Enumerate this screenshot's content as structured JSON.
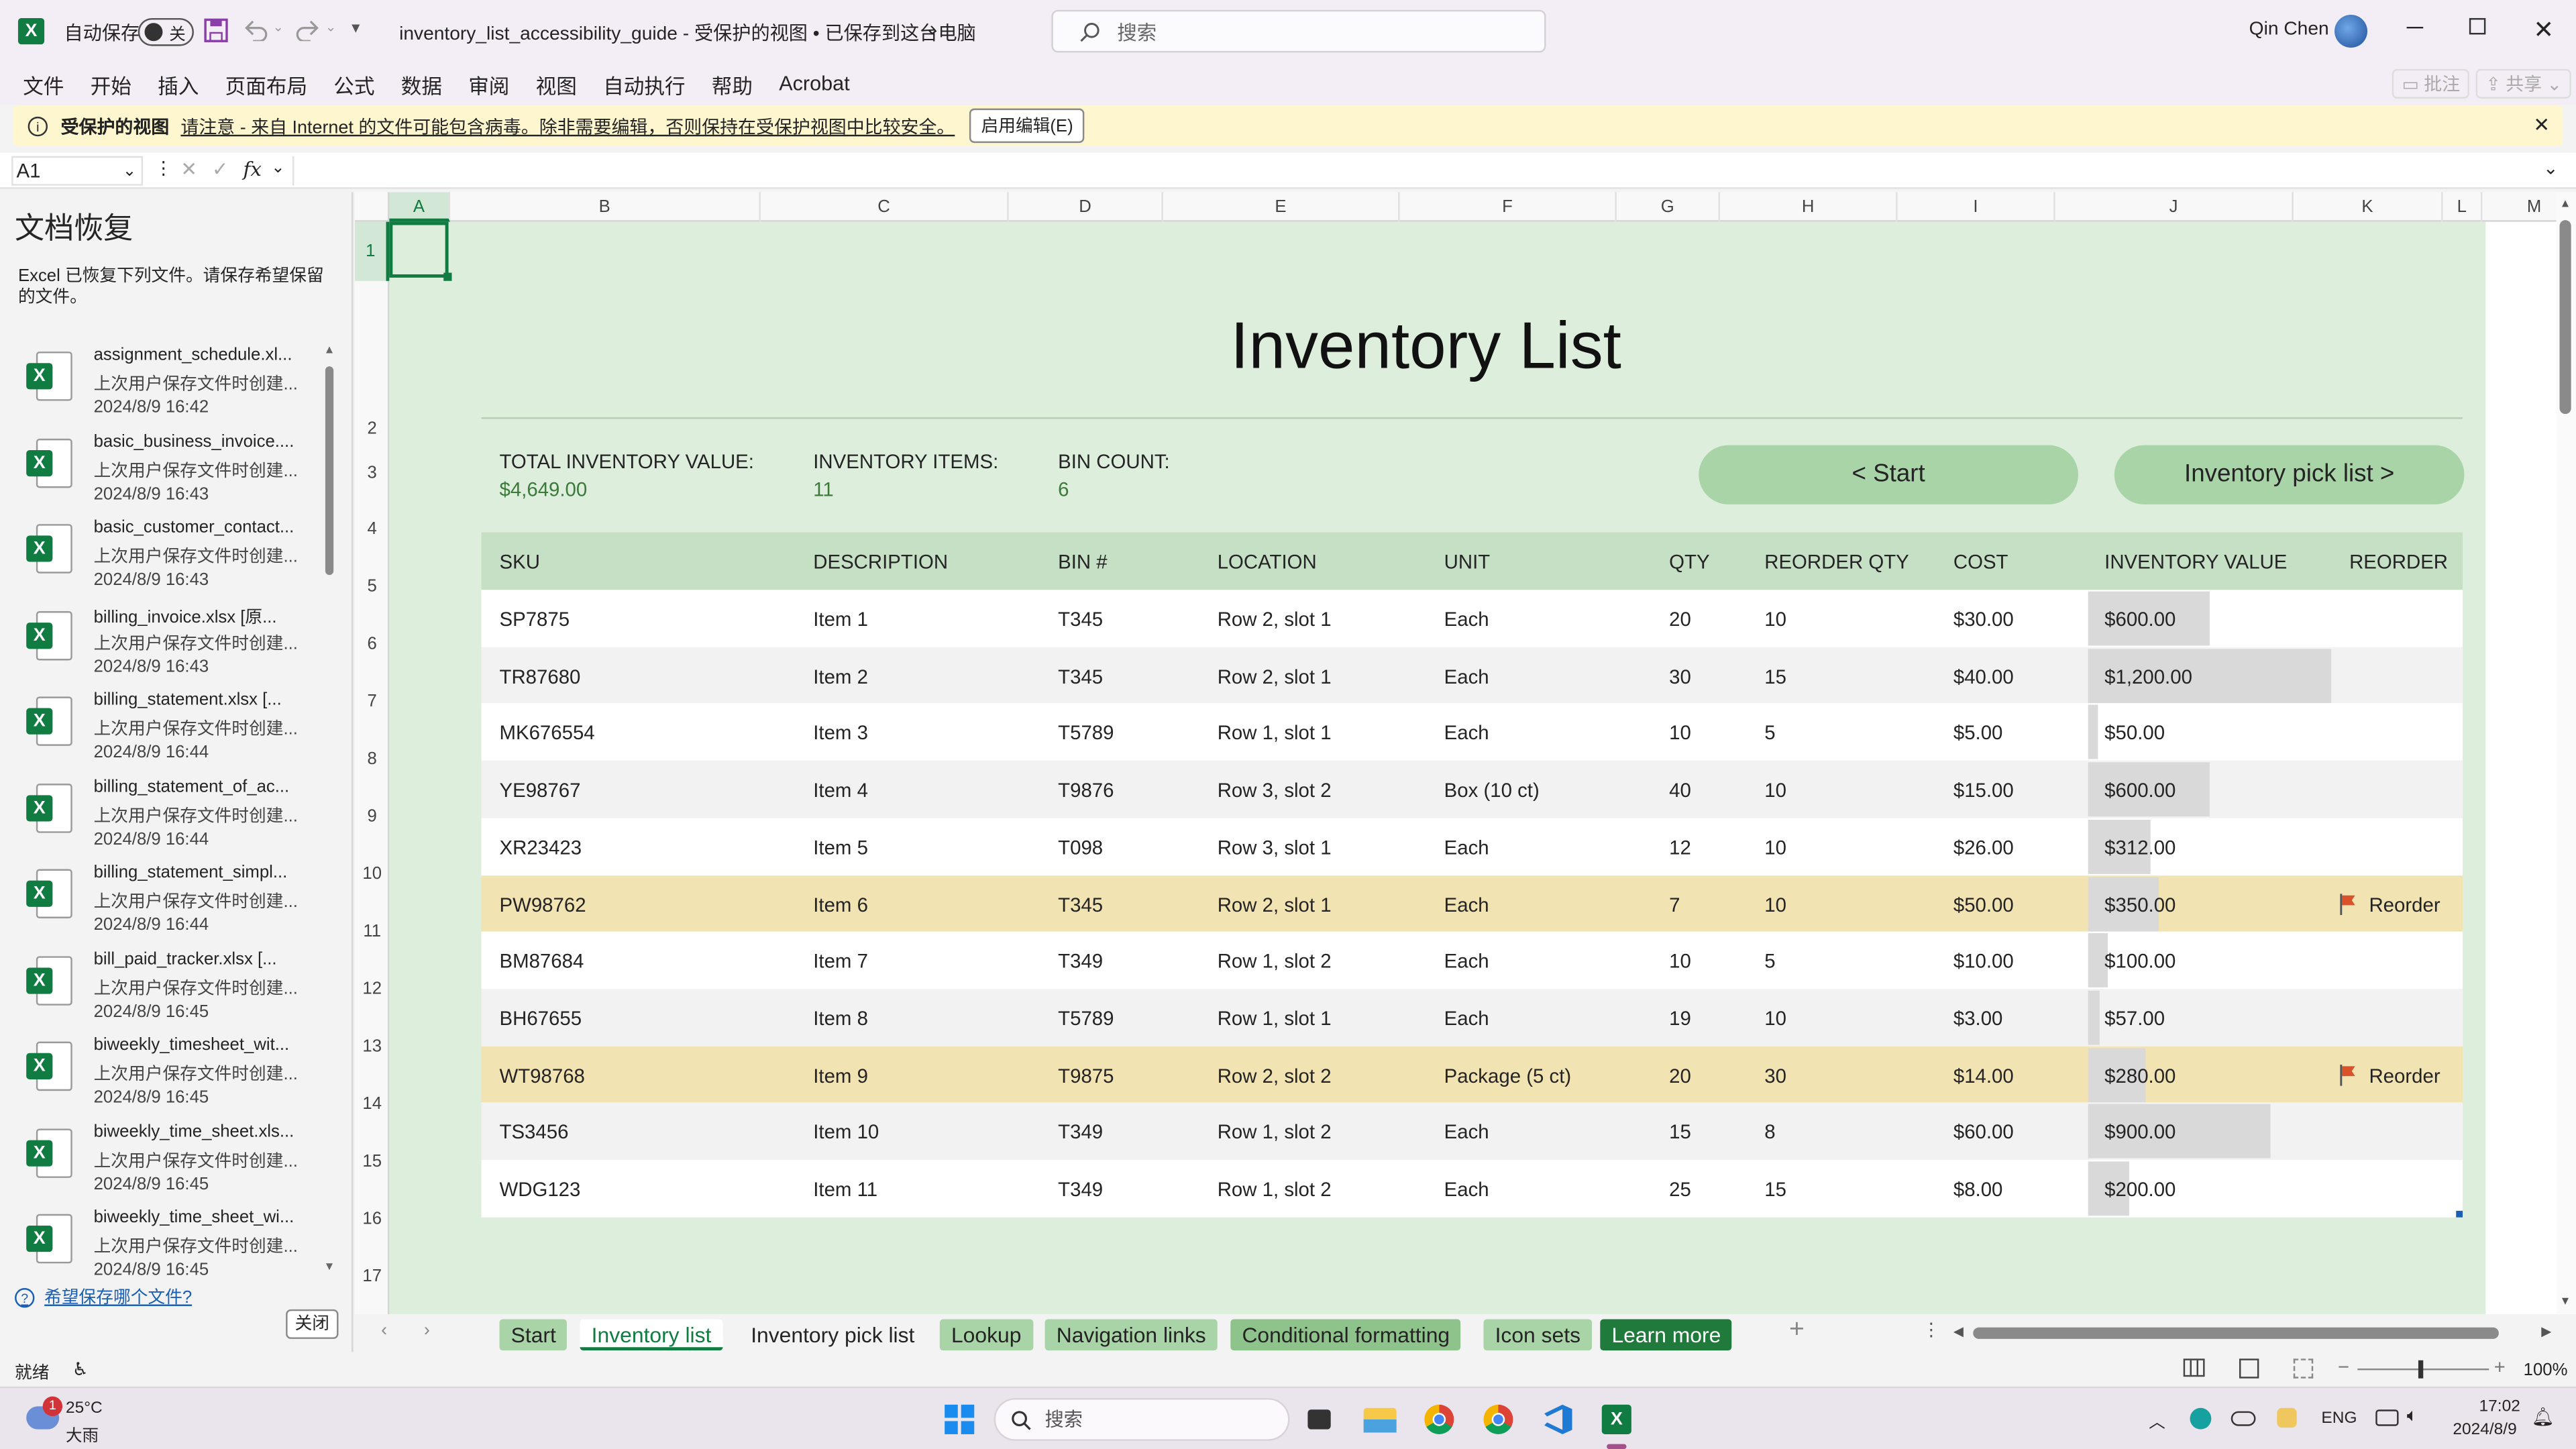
{
  "titlebar": {
    "autosave_label": "自动保存",
    "autosave_state": "关",
    "doc_title": "inventory_list_accessibility_guide  -  受保护的视图 • 已保存到这台电脑",
    "search_placeholder": "搜索",
    "user_name": "Qin Chen"
  },
  "menu": {
    "items": [
      "文件",
      "开始",
      "插入",
      "页面布局",
      "公式",
      "数据",
      "审阅",
      "视图",
      "自动执行",
      "帮助",
      "Acrobat"
    ],
    "comments": "批注",
    "share": "共享"
  },
  "infobar": {
    "title": "受保护的视图",
    "message": "请注意 - 来自 Internet 的文件可能包含病毒。除非需要编辑，否则保持在受保护视图中比较安全。",
    "button": "启用编辑(E)"
  },
  "formula_bar": {
    "name_box": "A1",
    "fx": "fx"
  },
  "recovery": {
    "title": "文档恢复",
    "description": "Excel 已恢复下列文件。请保存希望保留的文件。",
    "files": [
      {
        "name": "assignment_schedule.xl...",
        "sub": "上次用户保存文件时创建...",
        "date": "2024/8/9 16:42"
      },
      {
        "name": "basic_business_invoice....",
        "sub": "上次用户保存文件时创建...",
        "date": "2024/8/9 16:43"
      },
      {
        "name": "basic_customer_contact...",
        "sub": "上次用户保存文件时创建...",
        "date": "2024/8/9 16:43"
      },
      {
        "name": "billing_invoice.xlsx  [原...",
        "sub": "上次用户保存文件时创建...",
        "date": "2024/8/9 16:43"
      },
      {
        "name": "billing_statement.xlsx  [...",
        "sub": "上次用户保存文件时创建...",
        "date": "2024/8/9 16:44"
      },
      {
        "name": "billing_statement_of_ac...",
        "sub": "上次用户保存文件时创建...",
        "date": "2024/8/9 16:44"
      },
      {
        "name": "billing_statement_simpl...",
        "sub": "上次用户保存文件时创建...",
        "date": "2024/8/9 16:44"
      },
      {
        "name": "bill_paid_tracker.xlsx  [...",
        "sub": "上次用户保存文件时创建...",
        "date": "2024/8/9 16:45"
      },
      {
        "name": "biweekly_timesheet_wit...",
        "sub": "上次用户保存文件时创建...",
        "date": "2024/8/9 16:45"
      },
      {
        "name": "biweekly_time_sheet.xls...",
        "sub": "上次用户保存文件时创建...",
        "date": "2024/8/9 16:45"
      },
      {
        "name": "biweekly_time_sheet_wi...",
        "sub": "上次用户保存文件时创建...",
        "date": "2024/8/9 16:45"
      }
    ],
    "link": "希望保存哪个文件?",
    "close": "关闭"
  },
  "columns": [
    "A",
    "B",
    "C",
    "D",
    "E",
    "F",
    "G",
    "H",
    "I",
    "J",
    "K",
    "L",
    "M"
  ],
  "rows": [
    "1",
    "2",
    "3",
    "4",
    "5",
    "6",
    "7",
    "8",
    "9",
    "10",
    "11",
    "12",
    "13",
    "14",
    "15",
    "16",
    "17"
  ],
  "sheet": {
    "title": "Inventory List",
    "summary": [
      {
        "label": "TOTAL INVENTORY VALUE:",
        "value": "$4,649.00"
      },
      {
        "label": "INVENTORY ITEMS:",
        "value": "11"
      },
      {
        "label": "BIN COUNT:",
        "value": "6"
      }
    ],
    "buttons": {
      "start": "< Start",
      "pick": "Inventory pick list >"
    },
    "headers": [
      "SKU",
      "DESCRIPTION",
      "BIN #",
      "LOCATION",
      "UNIT",
      "QTY",
      "REORDER QTY",
      "COST",
      "INVENTORY VALUE",
      "REORDER"
    ],
    "reorder_label": "Reorder",
    "max_value": 1200,
    "items": [
      {
        "sku": "SP7875",
        "desc": "Item 1",
        "bin": "T345",
        "loc": "Row 2, slot 1",
        "unit": "Each",
        "qty": "20",
        "rqty": "10",
        "cost": "$30.00",
        "value": "$600.00",
        "v": 600,
        "reorder": false
      },
      {
        "sku": "TR87680",
        "desc": "Item 2",
        "bin": "T345",
        "loc": "Row 2, slot 1",
        "unit": "Each",
        "qty": "30",
        "rqty": "15",
        "cost": "$40.00",
        "value": "$1,200.00",
        "v": 1200,
        "reorder": false
      },
      {
        "sku": "MK676554",
        "desc": "Item 3",
        "bin": "T5789",
        "loc": "Row 1, slot 1",
        "unit": "Each",
        "qty": "10",
        "rqty": "5",
        "cost": "$5.00",
        "value": "$50.00",
        "v": 50,
        "reorder": false
      },
      {
        "sku": "YE98767",
        "desc": "Item 4",
        "bin": "T9876",
        "loc": "Row 3, slot 2",
        "unit": "Box (10 ct)",
        "qty": "40",
        "rqty": "10",
        "cost": "$15.00",
        "value": "$600.00",
        "v": 600,
        "reorder": false
      },
      {
        "sku": "XR23423",
        "desc": "Item 5",
        "bin": "T098",
        "loc": "Row 3, slot 1",
        "unit": "Each",
        "qty": "12",
        "rqty": "10",
        "cost": "$26.00",
        "value": "$312.00",
        "v": 312,
        "reorder": false
      },
      {
        "sku": "PW98762",
        "desc": "Item 6",
        "bin": "T345",
        "loc": "Row 2, slot 1",
        "unit": "Each",
        "qty": "7",
        "rqty": "10",
        "cost": "$50.00",
        "value": "$350.00",
        "v": 350,
        "reorder": true
      },
      {
        "sku": "BM87684",
        "desc": "Item 7",
        "bin": "T349",
        "loc": "Row 1, slot 2",
        "unit": "Each",
        "qty": "10",
        "rqty": "5",
        "cost": "$10.00",
        "value": "$100.00",
        "v": 100,
        "reorder": false
      },
      {
        "sku": "BH67655",
        "desc": "Item 8",
        "bin": "T5789",
        "loc": "Row 1, slot 1",
        "unit": "Each",
        "qty": "19",
        "rqty": "10",
        "cost": "$3.00",
        "value": "$57.00",
        "v": 57,
        "reorder": false
      },
      {
        "sku": "WT98768",
        "desc": "Item 9",
        "bin": "T9875",
        "loc": "Row 2, slot 2",
        "unit": "Package (5 ct)",
        "qty": "20",
        "rqty": "30",
        "cost": "$14.00",
        "value": "$280.00",
        "v": 280,
        "reorder": true
      },
      {
        "sku": "TS3456",
        "desc": "Item 10",
        "bin": "T349",
        "loc": "Row 1, slot 2",
        "unit": "Each",
        "qty": "15",
        "rqty": "8",
        "cost": "$60.00",
        "value": "$900.00",
        "v": 900,
        "reorder": false
      },
      {
        "sku": "WDG123",
        "desc": "Item 11",
        "bin": "T349",
        "loc": "Row 1, slot 2",
        "unit": "Each",
        "qty": "25",
        "rqty": "15",
        "cost": "$8.00",
        "value": "$200.00",
        "v": 200,
        "reorder": false
      }
    ]
  },
  "tabs": {
    "items": [
      "Start",
      "Inventory list",
      "Inventory pick list",
      "Lookup",
      "Navigation links",
      "Conditional formatting",
      "Icon sets",
      "Learn more"
    ],
    "active": "Inventory list"
  },
  "status": {
    "ready": "就绪",
    "zoom": "100%"
  },
  "taskbar": {
    "temp": "25°C",
    "weather": "大雨",
    "weather_badge": "1",
    "search_placeholder": "搜索",
    "lang": "ENG",
    "time": "17:02",
    "date": "2024/8/9"
  },
  "colors": {
    "sheet_bg": "#deeedd",
    "header_row": "#c6e0c6",
    "button_green": "#a9d4a7",
    "reorder_row": "#f2e3b3",
    "alt_row": "#f2f2f2",
    "excel_green": "#107c41",
    "flag": "#d9522a"
  }
}
